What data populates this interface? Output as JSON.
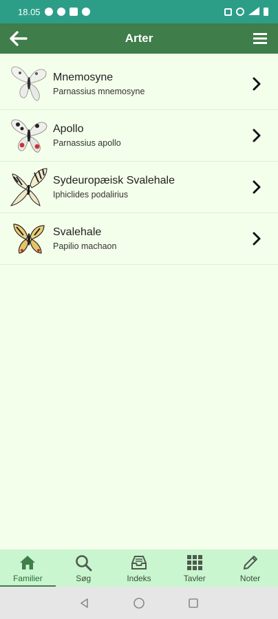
{
  "status_bar": {
    "time": "18.05"
  },
  "app_bar": {
    "title": "Arter"
  },
  "species": [
    {
      "common": "Mnemosyne",
      "latin": "Parnassius mnemosyne",
      "icon": "butterfly-white"
    },
    {
      "common": "Apollo",
      "latin": "Parnassius apollo",
      "icon": "butterfly-white-spotted"
    },
    {
      "common": "Sydeuropæisk Svalehale",
      "latin": "Iphiclides podalirius",
      "icon": "butterfly-striped"
    },
    {
      "common": "Svalehale",
      "latin": "Papilio machaon",
      "icon": "butterfly-yellow"
    }
  ],
  "bottom_nav": [
    {
      "label": "Familier",
      "icon": "home-icon",
      "active": true
    },
    {
      "label": "Søg",
      "icon": "search-icon",
      "active": false
    },
    {
      "label": "Indeks",
      "icon": "inbox-icon",
      "active": false
    },
    {
      "label": "Tavler",
      "icon": "grid-icon",
      "active": false
    },
    {
      "label": "Noter",
      "icon": "pencil-icon",
      "active": false
    }
  ],
  "colors": {
    "status_bar": "#2c9e88",
    "app_bar": "#3f7d4a",
    "background": "#f4ffeb",
    "bottom_nav": "#c9f5cf"
  }
}
